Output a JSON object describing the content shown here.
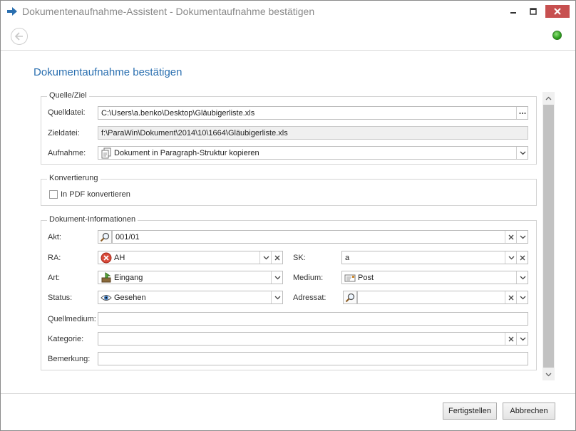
{
  "window": {
    "title": "Dokumentenaufnahme-Assistent - Dokumentaufnahme bestätigen"
  },
  "page": {
    "heading": "Dokumentaufnahme bestätigen"
  },
  "quelle_ziel": {
    "legend": "Quelle/Ziel",
    "quelldatei": {
      "label": "Quelldatei:",
      "value": "C:\\Users\\a.benko\\Desktop\\Gläubigerliste.xls"
    },
    "zieldatei": {
      "label": "Zieldatei:",
      "value": "f:\\ParaWin\\Dokument\\2014\\10\\1664\\Gläubigerliste.xls"
    },
    "aufnahme": {
      "label": "Aufnahme:",
      "value": "Dokument in Paragraph-Struktur kopieren"
    }
  },
  "konvertierung": {
    "legend": "Konvertierung",
    "pdf": {
      "label": "In PDF konvertieren",
      "checked": false
    }
  },
  "dokument_info": {
    "legend": "Dokument-Informationen",
    "akt": {
      "label": "Akt:",
      "value": "001/01"
    },
    "ra": {
      "label": "RA:",
      "value": "AH"
    },
    "sk": {
      "label": "SK:",
      "value": "a"
    },
    "art": {
      "label": "Art:",
      "value": "Eingang"
    },
    "medium": {
      "label": "Medium:",
      "value": "Post"
    },
    "status": {
      "label": "Status:",
      "value": "Gesehen"
    },
    "adressat": {
      "label": "Adressat:",
      "value": ""
    },
    "quellmedium": {
      "label": "Quellmedium:",
      "value": ""
    },
    "kategorie": {
      "label": "Kategorie:",
      "value": ""
    },
    "bemerkung": {
      "label": "Bemerkung:",
      "value": ""
    }
  },
  "footer": {
    "finish_label": "Fertigstellen",
    "cancel_label": "Abbrechen"
  },
  "colors": {
    "accent": "#2a6fb0",
    "status_ok": "#2fa01f",
    "close_btn": "#c75050"
  }
}
